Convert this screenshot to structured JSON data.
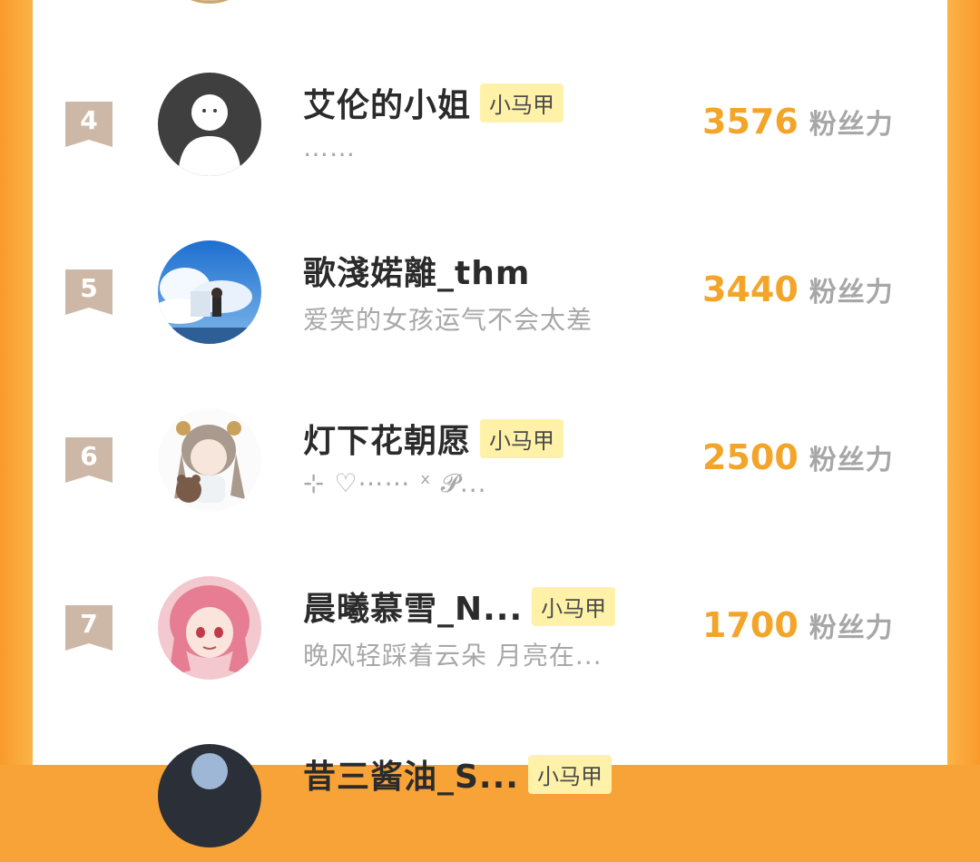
{
  "rows": [
    {
      "rank": "4",
      "name": "艾伦的小姐",
      "tag": "小马甲",
      "signature": "……",
      "score": "3576",
      "score_unit": "粉丝力",
      "avatar_icon": "default-person-avatar"
    },
    {
      "rank": "5",
      "name": "歌淺婼離_thm",
      "tag": "",
      "signature": "爱笑的女孩运气不会太差",
      "score": "3440",
      "score_unit": "粉丝力",
      "avatar_icon": "sky-girl-avatar"
    },
    {
      "rank": "6",
      "name": "灯下花朝愿",
      "tag": "小马甲",
      "signature": "⊹ ♡⋯⋯ ˣ 𝓟...",
      "score": "2500",
      "score_unit": "粉丝力",
      "avatar_icon": "anime-girl-bear-avatar"
    },
    {
      "rank": "7",
      "name": "晨曦慕雪_N...",
      "tag": "小马甲",
      "signature": "晚风轻踩着云朵 月亮在...",
      "score": "1700",
      "score_unit": "粉丝力",
      "avatar_icon": "pink-hair-anime-avatar"
    }
  ],
  "partial_next": {
    "name": "昔三酱油_S...",
    "tag": "小马甲"
  },
  "colors": {
    "background": "#f7a338",
    "score": "#f3a52a",
    "rank_badge": "#cdb8a7",
    "tag_bg": "#fff2a8"
  }
}
